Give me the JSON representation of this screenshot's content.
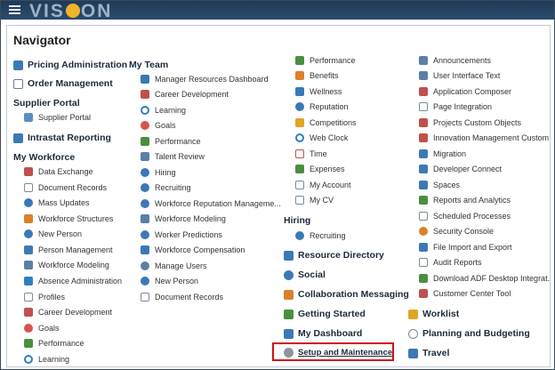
{
  "app": {
    "logo_text_left": "VIS",
    "logo_text_right": "ON"
  },
  "navigator": {
    "title": "Navigator"
  },
  "col1": {
    "groups": [
      {
        "label": "Pricing Administration",
        "icon": "table-icon"
      },
      {
        "label": "Order Management",
        "icon": "document-icon"
      }
    ],
    "supplier_portal": {
      "header": "Supplier Portal",
      "items": [
        "Supplier Portal"
      ]
    },
    "intrastat": {
      "label": "Intrastat Reporting"
    },
    "my_workforce": {
      "header": "My Workforce",
      "items": [
        "Data Exchange",
        "Document Records",
        "Mass Updates",
        "Workforce Structures",
        "New Person",
        "Person Management",
        "Workforce Modeling",
        "Absence Administration",
        "Profiles",
        "Career Development",
        "Goals",
        "Performance",
        "Learning"
      ]
    }
  },
  "col2": {
    "header": "My Team",
    "items": [
      "Manager Resources Dashboard",
      "Career Development",
      "Learning",
      "Goals",
      "Performance",
      "Talent Review",
      "Hiring",
      "Recruiting",
      "Workforce Reputation Manageme...",
      "Workforce Modeling",
      "Worker Predictions",
      "Workforce Compensation",
      "Manage Users",
      "New Person",
      "Document Records"
    ]
  },
  "col3": {
    "items": [
      "Performance",
      "Benefits",
      "Wellness",
      "Reputation",
      "Competitions",
      "Web Clock",
      "Time",
      "Expenses",
      "My Account",
      "My CV"
    ],
    "hiring": {
      "header": "Hiring",
      "items": [
        "Recruiting"
      ]
    },
    "groups": [
      "Resource Directory",
      "Social",
      "Collaboration Messaging",
      "Getting Started",
      "My Dashboard",
      "Setup and Maintenance"
    ]
  },
  "col4": {
    "items": [
      "Announcements",
      "User Interface Text",
      "Application Composer",
      "Page Integration",
      "Projects Custom Objects",
      "Innovation Management Custom ...",
      "Migration",
      "Developer Connect",
      "Spaces",
      "Reports and Analytics",
      "Scheduled Processes",
      "Security Console",
      "File Import and Export",
      "Audit Reports",
      "Download ADF Desktop Integrat...",
      "Customer Center Tool"
    ],
    "groups": [
      "Worklist",
      "Planning and Budgeting",
      "Travel"
    ]
  },
  "colors": {
    "highlight": "#d01010",
    "topbar": "#2c4c6e",
    "accent": "#f0b429"
  }
}
